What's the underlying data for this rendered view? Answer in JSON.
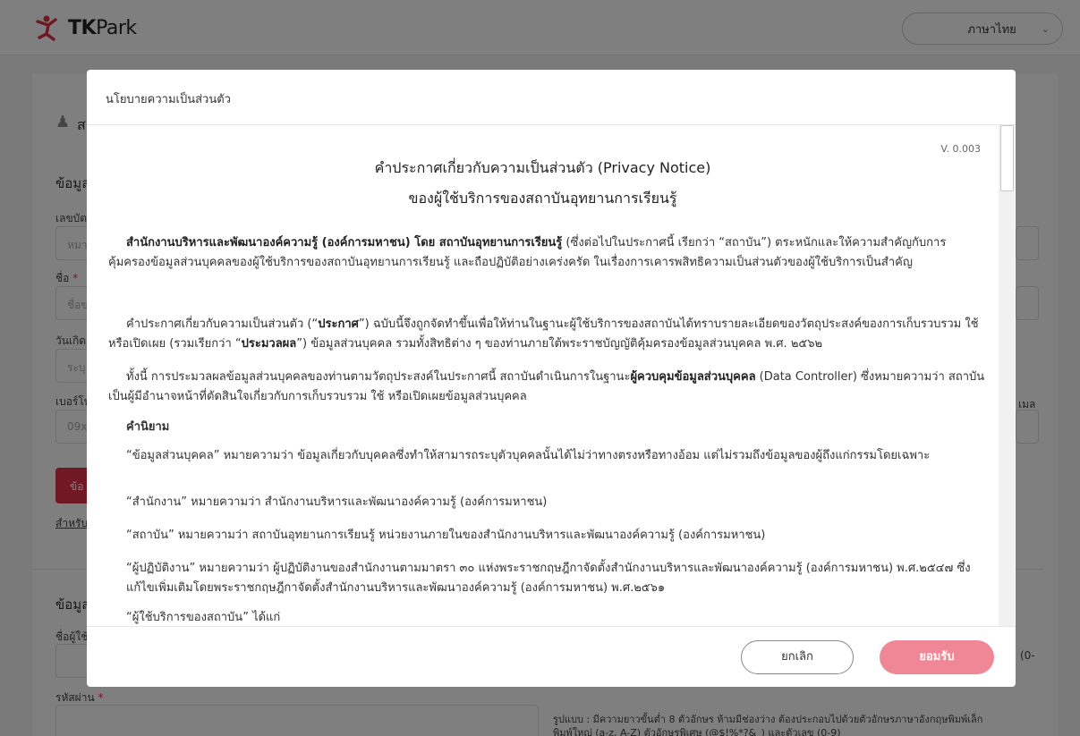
{
  "header": {
    "logo_text_tk": "TK",
    "logo_text_park": "Park",
    "language": "ภาษาไทย"
  },
  "background_form": {
    "section_icon_text": "ส",
    "section1_title": "ข้อมูล",
    "id_label": "เลขบัต",
    "id_placeholder": "หมา",
    "name_label": "ชื่อ",
    "name_placeholder": "ชื่อข",
    "birth_label": "วันเกิด",
    "birth_placeholder": "ระบุ",
    "phone_label": "เบอร์โท",
    "phone_placeholder": "09x",
    "email_label_fragment": "เมล",
    "red_button": "ข้อ",
    "link_text": "สำหรับ",
    "section2_title": "ข้อมูล",
    "username_label": "ชื่อผู้ใช้",
    "username_hint_fragment": "(0-",
    "password_label": "รหัสผ่าน",
    "password_hint_line1": "รูปแบบ : มีความยาวขั้นต่ำ 8 ตัวอักษร ห้ามมีช่องว่าง ต้องประกอบไปด้วยตัวอักษรภาษาอังกฤษพิมพ์เล็ก",
    "password_hint_line2": "พิมพ์ใหญ่ (a-z, A-Z) ตัวอักษรพิเศษ (@$!%*?&_) และตัวเลข (0-9)"
  },
  "modal": {
    "title": "นโยบายความเป็นส่วนตัว",
    "version": "V. 0.003",
    "doc_title_1": "คำประกาศเกี่ยวกับความเป็นส่วนตัว (Privacy Notice)",
    "doc_title_2": "ของผู้ใช้บริการของสถาบันอุทยานการเรียนรู้",
    "p1_bold": "สำนักงานบริหารและพัฒนาองค์ความรู้ (องค์การมหาชน) โดย สถาบันอุทยานการเรียนรู้",
    "p1_rest": " (ซึ่งต่อไปในประกาศนี้ เรียกว่า “สถาบัน”) ตระหนักและให้ความสำคัญกับการคุ้มครองข้อมูลส่วนบุคคลของผู้ใช้บริการของสถาบันอุทยานการเรียนรู้ และถือปฏิบัติอย่างเคร่งครัด ในเรื่องการเคารพสิทธิความเป็นส่วนตัวของผู้ใช้บริการเป็นสำคัญ",
    "p2_a": "คำประกาศเกี่ยวกับความเป็นส่วนตัว (“",
    "p2_b": "ประกาศ",
    "p2_c": "”) ฉบับนี้จึงถูกจัดทำขึ้นเพื่อให้ท่านในฐานะผู้ใช้บริการของสถาบันได้ทราบรายละเอียดของวัตถุประสงค์ของการเก็บรวบรวม ใช้ หรือเปิดเผย (รวมเรียกว่า “",
    "p2_d": "ประมวลผล",
    "p2_e": "”) ข้อมูลส่วนบุคคล รวมทั้งสิทธิต่าง ๆ ของท่านภายใต้พระราชบัญญัติคุ้มครองข้อมูลส่วนบุคคล พ.ศ. ๒๕๖๒",
    "p3_a": "ทั้งนี้ การประมวลผลข้อมูลส่วนบุคคลของท่านตามวัตถุประสงค์ในประกาศนี้ สถาบันดำเนินการในฐานะ",
    "p3_b": "ผู้ควบคุมข้อมูลส่วนบุคคล",
    "p3_c": " (Data Controller) ซึ่งหมายความว่า สถาบันเป็นผู้มีอำนาจหน้าที่ตัดสินใจเกี่ยวกับการเก็บรวบรวม ใช้ หรือเปิดเผยข้อมูลส่วนบุคคล",
    "definitions_heading": "คำนิยาม",
    "def1": "“ข้อมูลส่วนบุคคล” หมายความว่า ข้อมูลเกี่ยวกับบุคคลซึ่งทำให้สามารถระบุตัวบุคคลนั้นได้ไม่ว่าทางตรงหรือทางอ้อม แต่ไม่รวมถึงข้อมูลของผู้ถึงแก่กรรมโดยเฉพาะ",
    "def2": "“สำนักงาน” หมายความว่า สำนักงานบริหารและพัฒนาองค์ความรู้ (องค์การมหาชน)",
    "def3": "“สถาบัน” หมายความว่า สถาบันอุทยานการเรียนรู้ หน่วยงานภายในของสำนักงานบริหารและพัฒนาองค์ความรู้ (องค์การมหาชน)",
    "def4": "“ผู้ปฏิบัติงาน” หมายความว่า ผู้ปฏิบัติงานของสำนักงานตามมาตรา ๓๐ แห่งพระราชกฤษฎีกาจัดตั้งสำนักงานบริหารและพัฒนาองค์ความรู้ (องค์การมหาชน) พ.ศ.๒๕๔๗ ซึ่งแก้ไขเพิ่มเติมโดยพระราชกฤษฎีกาจัดตั้งสำนักงานบริหารและพัฒนาองค์ความรู้ (องค์การมหาชน) พ.ศ.๒๕๖๑",
    "def5": "“ผู้ใช้บริการของสถาบัน” ได้แก่",
    "cancel_label": "ยกเลิก",
    "accept_label": "ยอมรับ"
  },
  "colors": {
    "brand_red": "#e0334a",
    "accept_button": "#f08796",
    "overlay": "rgba(0,0,0,0.5)"
  }
}
